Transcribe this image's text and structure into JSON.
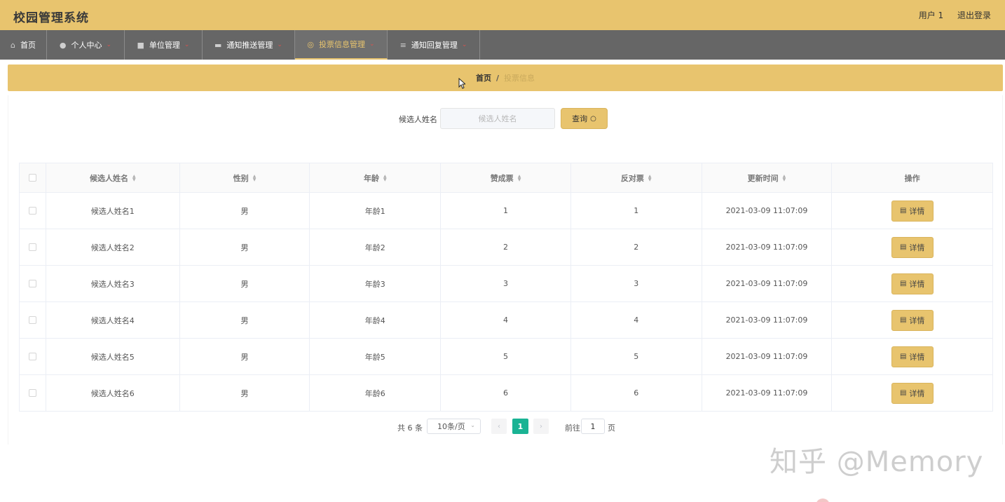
{
  "header": {
    "title": "校园管理系统",
    "user": "用户 1",
    "logout": "退出登录"
  },
  "nav": {
    "items": [
      {
        "label": "首页",
        "icon": "home-icon",
        "has_dropdown": false,
        "active": false
      },
      {
        "label": "个人中心",
        "icon": "user-icon",
        "has_dropdown": true,
        "active": false
      },
      {
        "label": "单位管理",
        "icon": "folder-icon",
        "has_dropdown": true,
        "active": false
      },
      {
        "label": "通知推送管理",
        "icon": "monitor-icon",
        "has_dropdown": true,
        "active": false
      },
      {
        "label": "投票信息管理",
        "icon": "globe-icon",
        "has_dropdown": true,
        "active": true
      },
      {
        "label": "通知回复管理",
        "icon": "list-icon",
        "has_dropdown": true,
        "active": false
      }
    ]
  },
  "breadcrumb": {
    "home": "首页",
    "separator": "/",
    "current": "投票信息"
  },
  "search": {
    "label": "候选人姓名",
    "placeholder": "候选人姓名",
    "button": "查询"
  },
  "table": {
    "columns": [
      "候选人姓名",
      "性别",
      "年龄",
      "赞成票",
      "反对票",
      "更新时间",
      "操作"
    ],
    "rows": [
      {
        "name": "候选人姓名1",
        "gender": "男",
        "age": "年龄1",
        "yes": "1",
        "no": "1",
        "updated": "2021-03-09 11:07:09"
      },
      {
        "name": "候选人姓名2",
        "gender": "男",
        "age": "年龄2",
        "yes": "2",
        "no": "2",
        "updated": "2021-03-09 11:07:09"
      },
      {
        "name": "候选人姓名3",
        "gender": "男",
        "age": "年龄3",
        "yes": "3",
        "no": "3",
        "updated": "2021-03-09 11:07:09"
      },
      {
        "name": "候选人姓名4",
        "gender": "男",
        "age": "年龄4",
        "yes": "4",
        "no": "4",
        "updated": "2021-03-09 11:07:09"
      },
      {
        "name": "候选人姓名5",
        "gender": "男",
        "age": "年龄5",
        "yes": "5",
        "no": "5",
        "updated": "2021-03-09 11:07:09"
      },
      {
        "name": "候选人姓名6",
        "gender": "男",
        "age": "年龄6",
        "yes": "6",
        "no": "6",
        "updated": "2021-03-09 11:07:09"
      }
    ],
    "action_label": "详情"
  },
  "pagination": {
    "total": "共 6 条",
    "page_size": "10条/页",
    "prev": "‹",
    "current_page": "1",
    "next": "›",
    "goto_label": "前往",
    "goto_value": "1",
    "goto_unit": "页"
  },
  "watermark": "知乎 @Memory",
  "colors": {
    "accent": "#e8c46e",
    "nav_bg": "#666666",
    "page_active": "#1ab394"
  }
}
